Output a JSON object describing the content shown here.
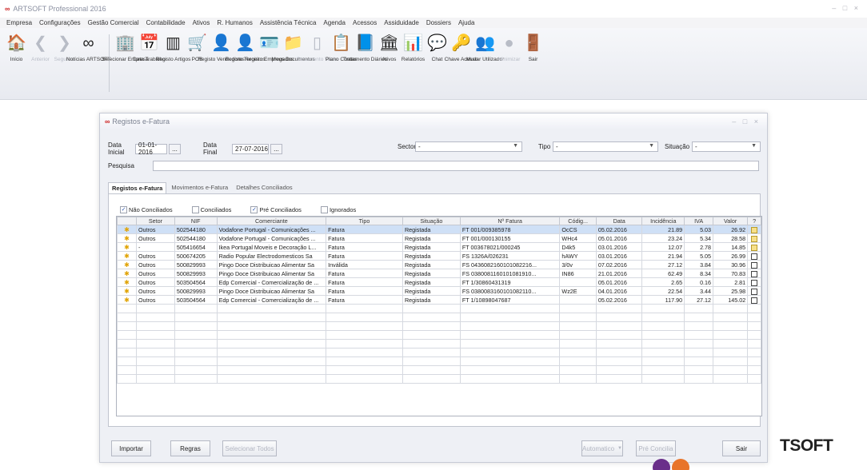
{
  "app": {
    "title": "ARTSOFT Professional 2016",
    "window_controls": "– □ ×"
  },
  "menu": [
    "Empresa",
    "Configurações",
    "Gestão Comercial",
    "Contabilidade",
    "Ativos",
    "R. Humanos",
    "Assistência Técnica",
    "Agenda",
    "Acessos",
    "Assiduidade",
    "Dossiers",
    "Ajuda"
  ],
  "ribbon": {
    "groups": [
      [
        {
          "label": "Início",
          "icon": "home-icon",
          "glyph": "🏠",
          "disabled": false
        },
        {
          "label": "Anterior",
          "icon": "back-arrow-icon",
          "glyph": "❮",
          "disabled": true
        },
        {
          "label": "Seguinte",
          "icon": "forward-arrow-icon",
          "glyph": "❯",
          "disabled": true
        },
        {
          "label": "Notícias ARTSOFT",
          "icon": "news-icon",
          "glyph": "∞",
          "disabled": false
        }
      ],
      [
        {
          "label": "Selecionar Empresa",
          "icon": "building-icon",
          "glyph": "🏢",
          "disabled": false
        },
        {
          "label": "Data Trabalho",
          "icon": "calendar-icon",
          "glyph": "📅",
          "disabled": false
        },
        {
          "label": "Registo Artigos",
          "icon": "barcode-icon",
          "glyph": "▥",
          "disabled": false
        },
        {
          "label": "POS",
          "icon": "cart-icon",
          "glyph": "🛒",
          "disabled": false
        },
        {
          "label": "Registo Vendedores",
          "icon": "person-icon",
          "glyph": "👤",
          "disabled": false
        },
        {
          "label": "Registo Terceiros",
          "icon": "person-icon",
          "glyph": "👤",
          "disabled": false
        },
        {
          "label": "Registo Empregados",
          "icon": "employee-icon",
          "glyph": "🪪",
          "disabled": false
        },
        {
          "label": "Meus Documentos",
          "icon": "folder-icon",
          "glyph": "📁",
          "disabled": false
        },
        {
          "label": "Documento Vazio",
          "icon": "blank-document-icon",
          "glyph": "▯",
          "disabled": true
        },
        {
          "label": "Plano Contas",
          "icon": "chart-of-accounts-icon",
          "glyph": "📋",
          "disabled": false
        },
        {
          "label": "Tratamento Diários",
          "icon": "journal-icon",
          "glyph": "📘",
          "disabled": false
        },
        {
          "label": "Ativos",
          "icon": "assets-icon",
          "glyph": "🏛",
          "disabled": false
        },
        {
          "label": "Relatórios",
          "icon": "reports-icon",
          "glyph": "📊",
          "disabled": false
        },
        {
          "label": "Chat",
          "icon": "chat-icon",
          "glyph": "💬",
          "disabled": false
        },
        {
          "label": "Chave Acesso",
          "icon": "key-icon",
          "glyph": "🔑",
          "disabled": false
        },
        {
          "label": "Mudar Utilizador",
          "icon": "switch-user-icon",
          "glyph": "👥",
          "disabled": false
        },
        {
          "label": "Minimizar",
          "icon": "minimize-icon",
          "glyph": "●",
          "disabled": true
        },
        {
          "label": "Sair",
          "icon": "exit-door-icon",
          "glyph": "🚪",
          "disabled": false
        }
      ]
    ]
  },
  "dialog": {
    "title": "Registos e-Fatura",
    "window_controls": "– □ ×",
    "filters": {
      "data_inicial_label": "Data Inicial",
      "data_inicial_value": "01-01-2016",
      "data_final_label": "Data Final",
      "data_final_value": "27-07-2016",
      "dots": "...",
      "sector_label": "Sector",
      "sector_value": "-",
      "tipo_label": "Tipo",
      "tipo_value": "-",
      "situacao_label": "Situação",
      "situacao_value": "-",
      "pesquisa_label": "Pesquisa",
      "pesquisa_value": ""
    },
    "tabs": [
      "Registos e-Fatura",
      "Movimentos e-Fatura",
      "Detalhes Conciliados"
    ],
    "checkboxes": [
      {
        "label": "Não Conciliados",
        "checked": true
      },
      {
        "label": "Conciliados",
        "checked": false
      },
      {
        "label": "Pré Conciliados",
        "checked": true
      },
      {
        "label": "Ignorados",
        "checked": false
      }
    ],
    "columns": [
      "",
      "Setor",
      "NIF",
      "Comerciante",
      "Tipo",
      "Situação",
      "Nº Fatura",
      "Códig...",
      "Data",
      "Incidência",
      "IVA",
      "Valor",
      "?"
    ],
    "rows": [
      {
        "pin": "✱",
        "setor": "Outros",
        "nif": "502544180",
        "comerciante": "Vodafone Portugal - Comunicações ...",
        "tipo": "Fatura",
        "situacao": "Registada",
        "fatura": "FT 001/009385978",
        "codigo": "OcCS",
        "data": "05.02.2016",
        "incidencia": "21.89",
        "iva": "5.03",
        "valor": "26.92",
        "doc": "y",
        "selected": true
      },
      {
        "pin": "✱",
        "setor": "Outros",
        "nif": "502544180",
        "comerciante": "Vodafone Portugal - Comunicações ...",
        "tipo": "Fatura",
        "situacao": "Registada",
        "fatura": "FT 001/000130155",
        "codigo": "WHc4",
        "data": "05.01.2016",
        "incidencia": "23.24",
        "iva": "5.34",
        "valor": "28.58",
        "doc": "y",
        "selected": false
      },
      {
        "pin": "✱",
        "setor": "-",
        "nif": "505416654",
        "comerciante": "Ikea Portugal Moveis e Decoração L...",
        "tipo": "Fatura",
        "situacao": "Registada",
        "fatura": "FT 003678021/000245",
        "codigo": "D4k5",
        "data": "03.01.2016",
        "incidencia": "12.07",
        "iva": "2.78",
        "valor": "14.85",
        "doc": "y",
        "selected": false
      },
      {
        "pin": "✱",
        "setor": "Outros",
        "nif": "500674205",
        "comerciante": "Radio Popular Electrodomesticos Sa",
        "tipo": "Fatura",
        "situacao": "Registada",
        "fatura": "FS 1326A/026231",
        "codigo": "hAWY",
        "data": "03.01.2016",
        "incidencia": "21.94",
        "iva": "5.05",
        "valor": "26.99",
        "doc": "n",
        "selected": false
      },
      {
        "pin": "✱",
        "setor": "Outros",
        "nif": "500829993",
        "comerciante": "Pingo Doce Distribuicao Alimentar Sa",
        "tipo": "Inválida",
        "situacao": "Registada",
        "fatura": "FS 0436082160101082216...",
        "codigo": "3/0v",
        "data": "07.02.2016",
        "incidencia": "27.12",
        "iva": "3.84",
        "valor": "30.96",
        "doc": "n",
        "selected": false
      },
      {
        "pin": "✱",
        "setor": "Outros",
        "nif": "500829993",
        "comerciante": "Pingo Doce Distribuicao Alimentar Sa",
        "tipo": "Fatura",
        "situacao": "Registada",
        "fatura": "FS 0380081160101081910...",
        "codigo": "IN86",
        "data": "21.01.2016",
        "incidencia": "62.49",
        "iva": "8.34",
        "valor": "70.83",
        "doc": "n",
        "selected": false
      },
      {
        "pin": "✱",
        "setor": "Outros",
        "nif": "503504564",
        "comerciante": "Edp Comercial - Comercialização de ...",
        "tipo": "Fatura",
        "situacao": "Registada",
        "fatura": "FT 1/30860431319",
        "codigo": "",
        "data": "05.01.2016",
        "incidencia": "2.65",
        "iva": "0.16",
        "valor": "2.81",
        "doc": "n",
        "selected": false
      },
      {
        "pin": "✱",
        "setor": "Outros",
        "nif": "500829993",
        "comerciante": "Pingo Doce Distribuicao Alimentar Sa",
        "tipo": "Fatura",
        "situacao": "Registada",
        "fatura": "FS 0380083160101082110...",
        "codigo": "Wz2E",
        "data": "04.01.2016",
        "incidencia": "22.54",
        "iva": "3.44",
        "valor": "25.98",
        "doc": "n",
        "selected": false
      },
      {
        "pin": "✱",
        "setor": "Outros",
        "nif": "503504564",
        "comerciante": "Edp Comercial - Comercialização de ...",
        "tipo": "Fatura",
        "situacao": "Registada",
        "fatura": "FT 1/10898047687",
        "codigo": "",
        "data": "05.02.2016",
        "incidencia": "117.90",
        "iva": "27.12",
        "valor": "145.02",
        "doc": "n",
        "selected": false
      }
    ],
    "empty_rows": 9,
    "buttons": {
      "importar": "Importar",
      "regras": "Regras",
      "selecionar_todos": "Selecionar Todos",
      "automatico": "Automatico",
      "pre_concilia": "Pré Concilia",
      "sair": "Sair"
    }
  },
  "brand_text": "TSOFT",
  "colors": {
    "selected_row": "#cfe0f6",
    "brand_purple": "#6a2f8a",
    "brand_orange": "#e8742a"
  }
}
